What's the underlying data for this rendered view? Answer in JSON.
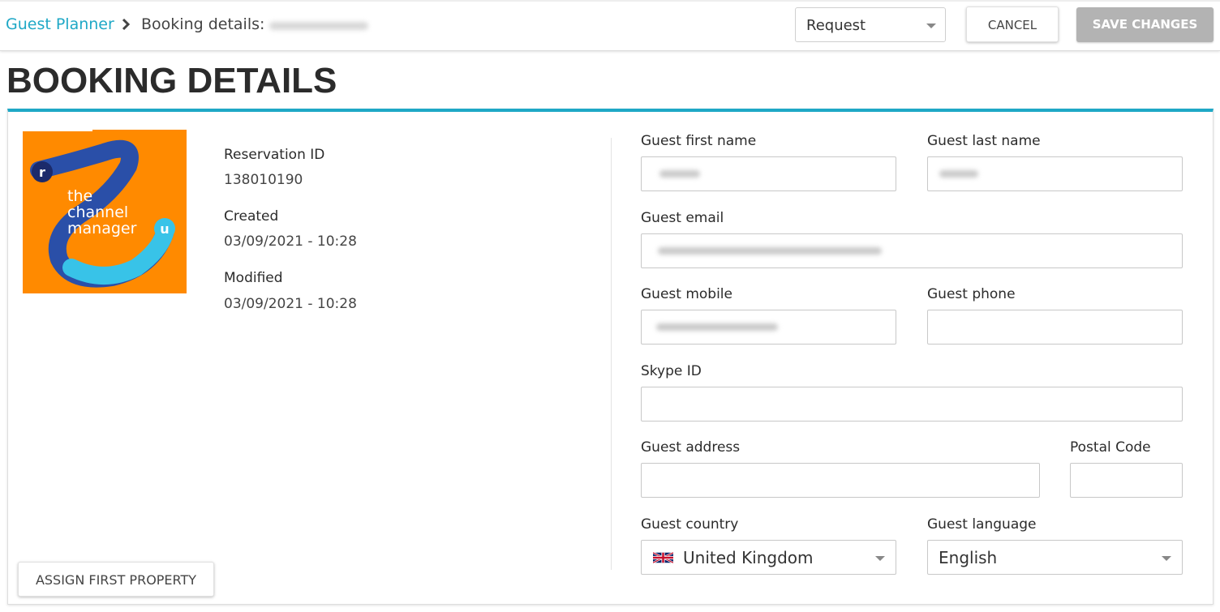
{
  "breadcrumb": {
    "root_label": "Guest Planner",
    "current_label": "Booking details:"
  },
  "header": {
    "status_value": "Request",
    "cancel_label": "CANCEL",
    "save_label": "SAVE CHANGES"
  },
  "page": {
    "title": "BOOKING DETAILS"
  },
  "logo": {
    "word1": "the",
    "word2": "channel",
    "word3": "manager",
    "letter_r": "r",
    "letter_u": "u",
    "background": "#FF8A00"
  },
  "meta": {
    "reservation_label": "Reservation ID",
    "reservation_value": "138010190",
    "created_label": "Created",
    "created_value": "03/09/2021 - 10:28",
    "modified_label": "Modified",
    "modified_value": "03/09/2021 - 10:28"
  },
  "form": {
    "first_name_label": "Guest first name",
    "last_name_label": "Guest last name",
    "email_label": "Guest email",
    "mobile_label": "Guest mobile",
    "phone_label": "Guest phone",
    "skype_label": "Skype ID",
    "address_label": "Guest address",
    "postal_label": "Postal Code",
    "country_label": "Guest country",
    "country_value": "United Kingdom",
    "language_label": "Guest language",
    "language_value": "English"
  },
  "actions": {
    "assign_label": "ASSIGN FIRST PROPERTY"
  },
  "colors": {
    "accent": "#1fa8c6",
    "save_disabled": "#b3b3b3"
  }
}
